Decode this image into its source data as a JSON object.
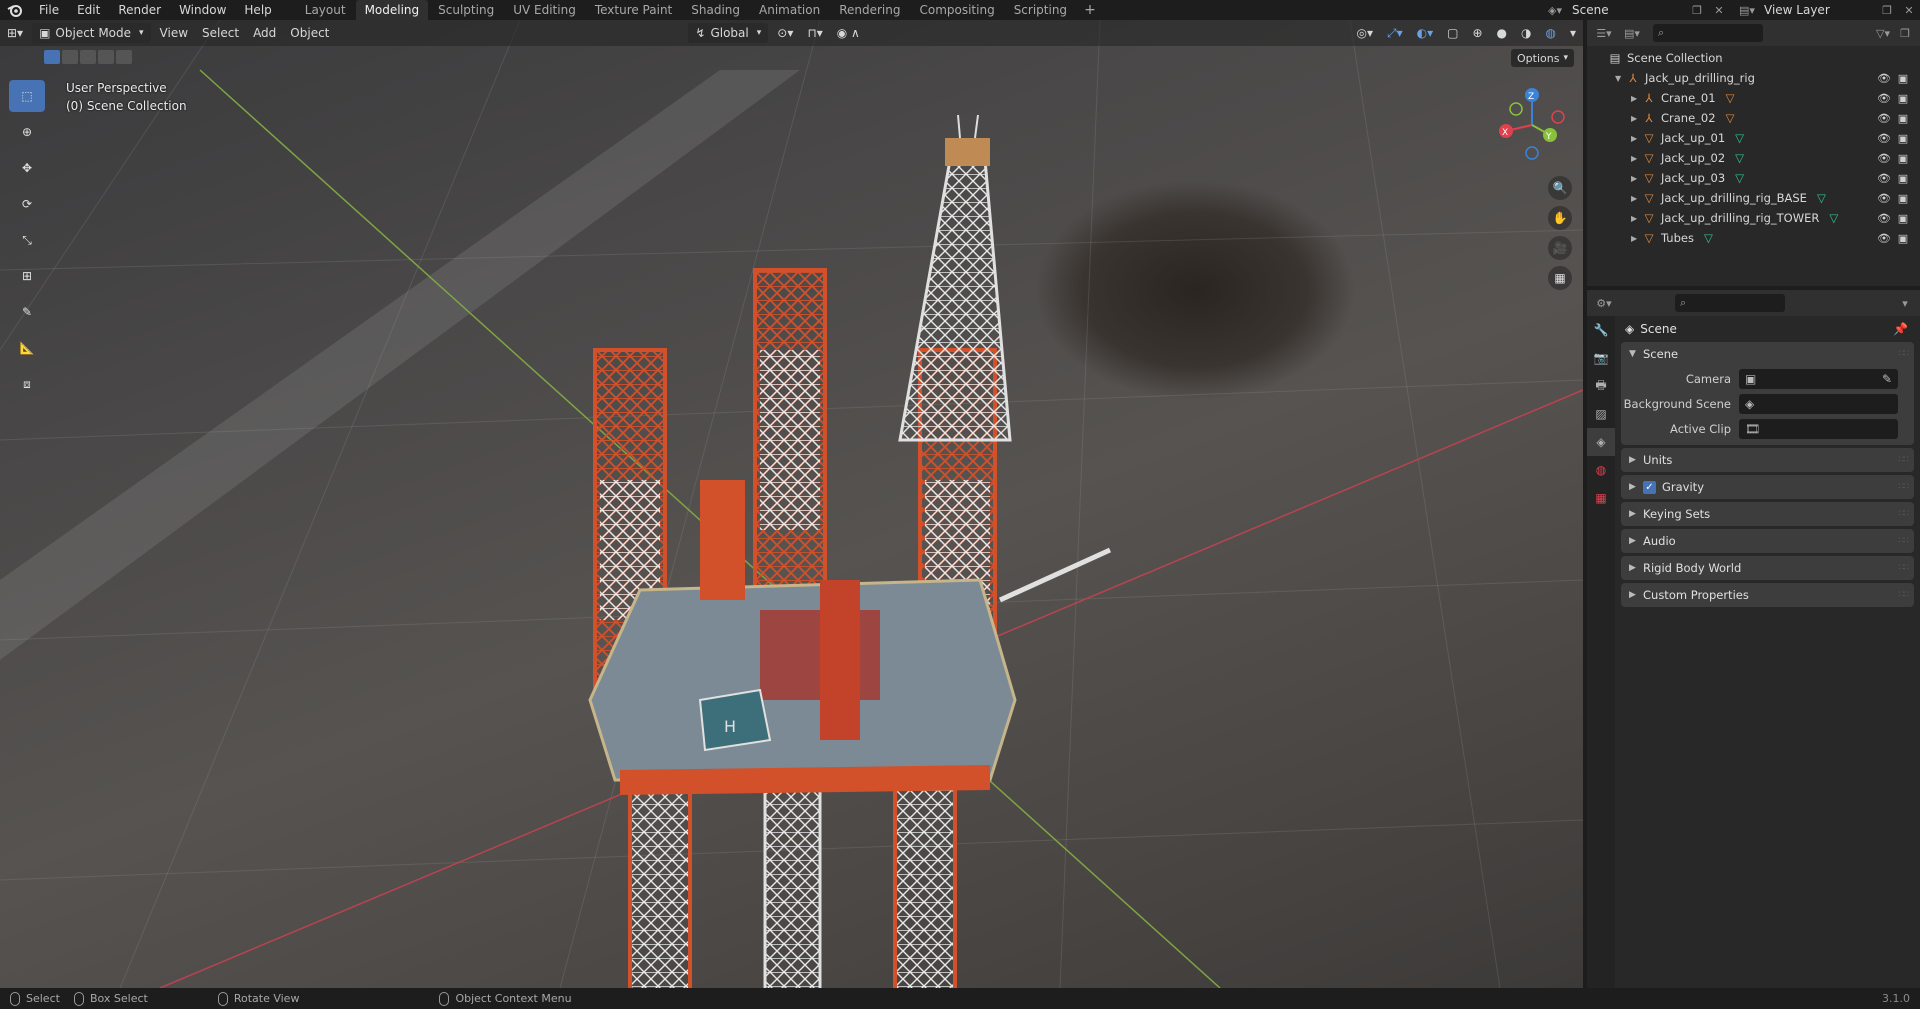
{
  "topbar": {
    "menus": [
      "File",
      "Edit",
      "Render",
      "Window",
      "Help"
    ],
    "workspaces": [
      "Layout",
      "Modeling",
      "Sculpting",
      "UV Editing",
      "Texture Paint",
      "Shading",
      "Animation",
      "Rendering",
      "Compositing",
      "Scripting"
    ],
    "active_workspace": "Modeling",
    "add_tab": "+",
    "scene_name": "Scene",
    "view_layer": "View Layer"
  },
  "viewport": {
    "mode": "Object Mode",
    "menus": [
      "View",
      "Select",
      "Add",
      "Object"
    ],
    "transform_orientation": "Global",
    "options_label": "Options",
    "overlay_line1": "User Perspective",
    "overlay_line2": "(0) Scene Collection",
    "gizmo_axes": {
      "x": "X",
      "y": "Y",
      "z": "Z"
    },
    "tools": [
      "select-box",
      "cursor",
      "move",
      "rotate",
      "scale",
      "transform",
      "annotate",
      "measure",
      "add-cube"
    ],
    "nav_buttons": [
      "zoom",
      "pan",
      "camera",
      "ortho"
    ]
  },
  "outliner": {
    "root": "Scene Collection",
    "collection": "Jack_up_drilling_rig",
    "items": [
      {
        "name": "Crane_01",
        "type": "armature"
      },
      {
        "name": "Crane_02",
        "type": "armature"
      },
      {
        "name": "Jack_up_01",
        "type": "mesh"
      },
      {
        "name": "Jack_up_02",
        "type": "mesh"
      },
      {
        "name": "Jack_up_03",
        "type": "mesh"
      },
      {
        "name": "Jack_up_drilling_rig_BASE",
        "type": "mesh"
      },
      {
        "name": "Jack_up_drilling_rig_TOWER",
        "type": "mesh"
      },
      {
        "name": "Tubes",
        "type": "mesh"
      }
    ]
  },
  "properties": {
    "context_title": "Scene",
    "scene_panel": {
      "title": "Scene",
      "camera_label": "Camera",
      "background_label": "Background Scene",
      "active_clip_label": "Active Clip"
    },
    "panels": [
      "Units",
      "Gravity",
      "Keying Sets",
      "Audio",
      "Rigid Body World",
      "Custom Properties"
    ],
    "gravity_enabled": true
  },
  "statusbar": {
    "select": "Select",
    "box_select": "Box Select",
    "rotate_view": "Rotate View",
    "context_menu": "Object Context Menu",
    "version": "3.1.0"
  },
  "colors": {
    "accent": "#4772b3",
    "rig_orange": "#d2502a",
    "x_axis": "#e0414f",
    "y_axis": "#8ac13a",
    "z_axis": "#3b83d9",
    "mesh_icon": "#e0893d",
    "data_icon": "#35c28d"
  }
}
